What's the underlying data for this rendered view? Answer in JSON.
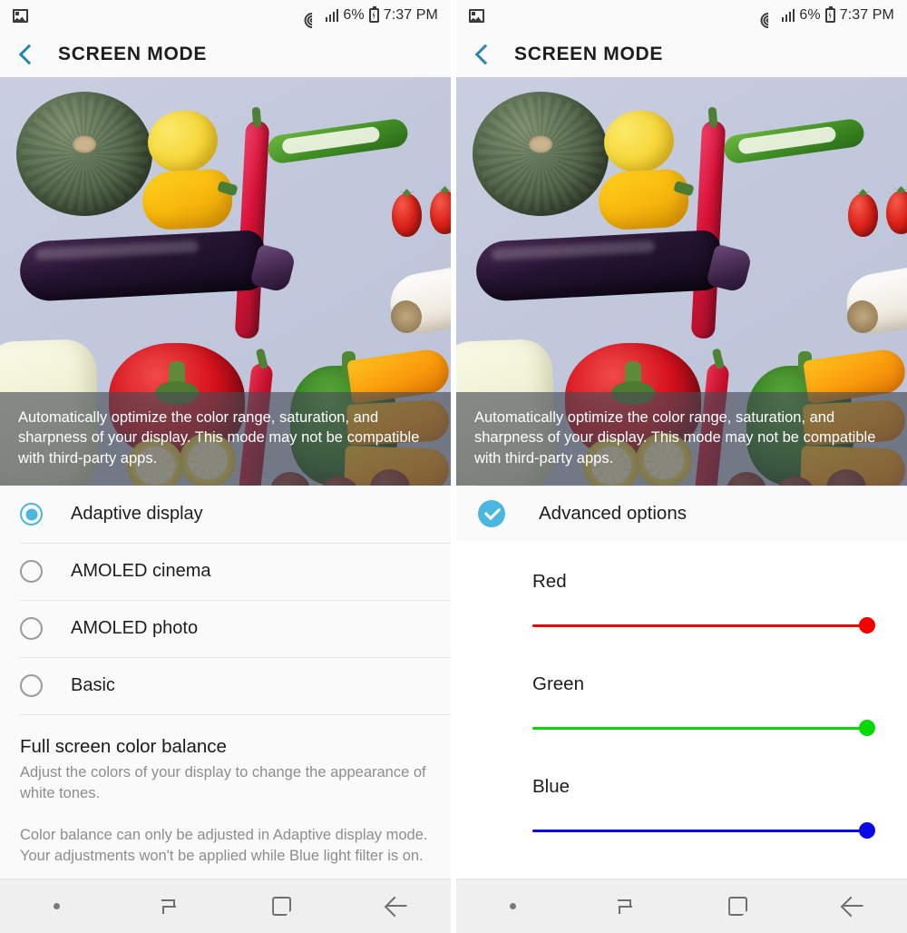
{
  "status_bar": {
    "left_icon": "image-icon",
    "wifi_icon": "wifi-icon",
    "signal_icon": "signal-bars-icon",
    "battery_percent": "6%",
    "battery_icon": "battery-charging-icon",
    "time": "7:37 PM"
  },
  "app_bar": {
    "back_icon": "back-chevron-icon",
    "title": "SCREEN MODE"
  },
  "preview": {
    "caption": "Automatically optimize the color range, saturation, and sharpness of your display. This mode may not be compatible with third-party apps."
  },
  "left_panel": {
    "options": [
      {
        "label": "Adaptive display",
        "selected": true
      },
      {
        "label": "AMOLED cinema",
        "selected": false
      },
      {
        "label": "AMOLED photo",
        "selected": false
      },
      {
        "label": "Basic",
        "selected": false
      }
    ],
    "color_balance": {
      "title": "Full screen color balance",
      "description": "Adjust the colors of your display to change the appearance of white tones.",
      "note": "Color balance can only be adjusted in Adaptive display mode. Your adjustments won't be applied while Blue light filter is on."
    }
  },
  "right_panel": {
    "advanced": {
      "label": "Advanced options",
      "checked": true,
      "check_icon": "check-circle-icon"
    },
    "sliders": [
      {
        "label": "Red",
        "color": "#f40000",
        "value": 100
      },
      {
        "label": "Green",
        "color": "#06d806",
        "value": 100
      },
      {
        "label": "Blue",
        "color": "#0a0ae6",
        "value": 100
      }
    ]
  },
  "nav_bar": {
    "items": [
      {
        "icon": "dot-indicator-icon",
        "label": ""
      },
      {
        "icon": "recents-icon",
        "label": ""
      },
      {
        "icon": "home-icon",
        "label": ""
      },
      {
        "icon": "back-arrow-icon",
        "label": ""
      }
    ]
  },
  "colors": {
    "accent": "#4bb6e0",
    "back_chevron": "#2c86ab",
    "red": "#f40000",
    "green": "#06d806",
    "blue": "#0a0ae6"
  }
}
